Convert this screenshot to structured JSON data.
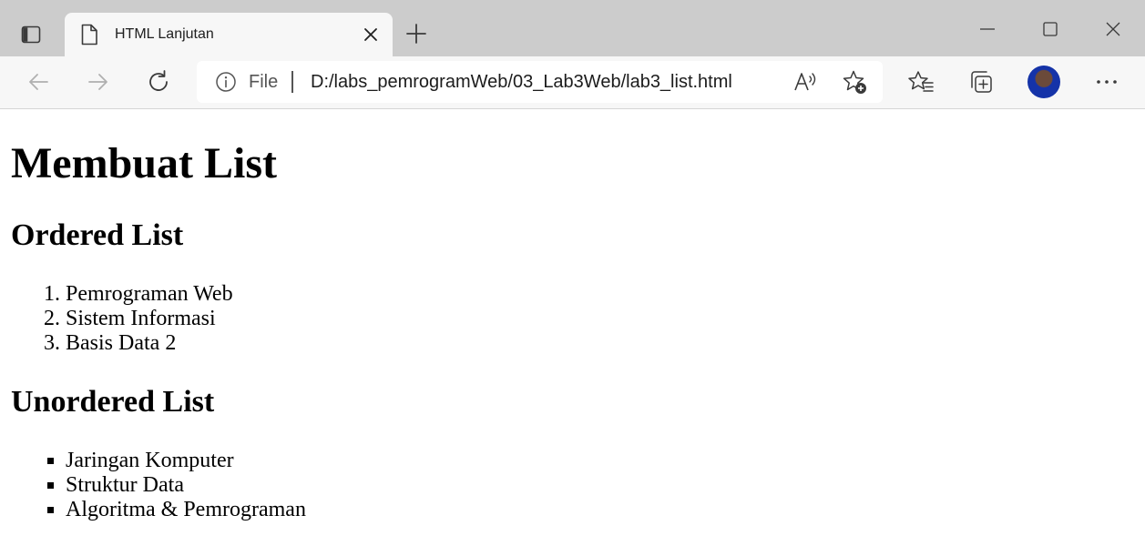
{
  "browser": {
    "tab": {
      "title": "HTML Lanjutan"
    },
    "address_bar": {
      "scheme_label": "File",
      "url": "D:/labs_pemrogramWeb/03_Lab3Web/lab3_list.html"
    },
    "colors": {
      "tabstrip_bg": "#cccccc",
      "active_tab_bg": "#f7f7f7",
      "toolbar_bg": "#f7f7f7",
      "icon_color": "#3a3a3a",
      "disabled_icon_color": "#b0b0b0"
    },
    "icons": [
      "tab-actions-icon",
      "page-icon",
      "close-icon",
      "plus-icon",
      "minimize-icon",
      "maximize-icon",
      "close-window-icon",
      "back-arrow-icon",
      "forward-arrow-icon",
      "refresh-icon",
      "info-icon",
      "read-aloud-icon",
      "add-favorite-icon",
      "favorites-icon",
      "collections-icon",
      "more-icon"
    ]
  },
  "page": {
    "heading": "Membuat List",
    "ordered": {
      "heading": "Ordered List",
      "items": [
        "Pemrograman Web",
        "Sistem Informasi",
        "Basis Data 2"
      ]
    },
    "unordered": {
      "heading": "Unordered List",
      "items": [
        "Jaringan Komputer",
        "Struktur Data",
        "Algoritma & Pemrograman"
      ]
    }
  }
}
